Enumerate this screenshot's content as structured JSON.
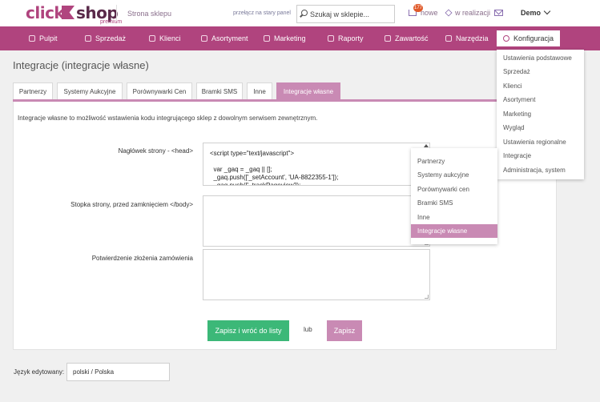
{
  "brand": {
    "part1": "click",
    "part2": "shop",
    "tag": "premium"
  },
  "topbar": {
    "store_link": "Strona sklepu",
    "old_panel_link": "przełącz na stary panel",
    "search_placeholder": "Szukaj w sklepie...",
    "new_badge": "177",
    "new_label": "nowe",
    "realization_label": "w realizacji",
    "user": "Demo"
  },
  "nav": {
    "items": [
      {
        "label": "Pulpit",
        "icon": "dashboard-icon"
      },
      {
        "label": "Sprzedaż",
        "icon": "cart-icon"
      },
      {
        "label": "Klienci",
        "icon": "users-icon"
      },
      {
        "label": "Asortyment",
        "icon": "box-icon"
      },
      {
        "label": "Marketing",
        "icon": "tag-icon"
      },
      {
        "label": "Raporty",
        "icon": "chart-icon"
      },
      {
        "label": "Zawartość",
        "icon": "document-icon"
      },
      {
        "label": "Narzędzia",
        "icon": "tools-icon"
      },
      {
        "label": "Konfiguracja",
        "icon": "gear-icon"
      }
    ]
  },
  "page": {
    "title": "Integracje (integracje własne)",
    "description": "Integracje własne to możliwość wstawienia kodu integrującego sklep z dowolnym serwisem zewnętrznym.",
    "tabs": [
      "Partnerzy",
      "Systemy Aukcyjne",
      "Porównywarki Cen",
      "Bramki SMS",
      "Inne",
      "Integracje własne"
    ],
    "fields": {
      "head_label": "Nagłówek strony - <head>",
      "head_code": "<script type=\"text/javascript\">\n\n  var _gaq = _gaq || [];\n  _gaq.push(['_setAccount', 'UA-8822355-1']);\n  _gaq.push(['_trackPageview']);",
      "footer_label": "Stopka strony, przed zamknięciem </body>",
      "confirm_label": "Potwierdzenie złożenia zamówienia"
    },
    "buttons": {
      "save_back": "Zapisz i wróć do listy",
      "or": "lub",
      "save": "Zapisz"
    },
    "language": {
      "label": "Język edytowany:",
      "value": "polski / Polska"
    }
  },
  "config_menu": {
    "items": [
      "Ustawienia podstawowe",
      "Sprzedaż",
      "Klienci",
      "Asortyment",
      "Marketing",
      "Wygląd",
      "Ustawienia regionalne",
      "Integracje",
      "Administracja, system"
    ]
  },
  "integrations_menu": {
    "items": [
      "Partnerzy",
      "Systemy aukcyjne",
      "Porównywarki cen",
      "Bramki SMS",
      "Inne",
      "Integracje własne"
    ]
  },
  "colors": {
    "brand": "#b0447e",
    "accent_light": "#c98ab4",
    "success": "#3cb878"
  }
}
